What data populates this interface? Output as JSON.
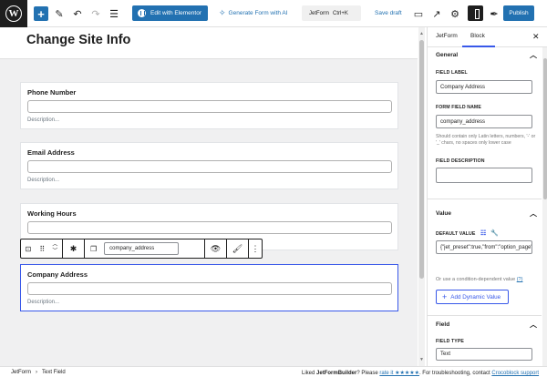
{
  "toolbar": {
    "logo": "W",
    "elementor_label": "Edit with Elementor",
    "generate_label": "Generate Form with AI",
    "command_label": "JetForm",
    "command_shortcut": "Ctrl+K",
    "save_draft_label": "Save draft",
    "publish_label": "Publish"
  },
  "editor": {
    "page_title": "Change Site Info",
    "fields": [
      {
        "label": "Phone Number",
        "description": "Description..."
      },
      {
        "label": "Email Address",
        "description": "Description..."
      },
      {
        "label": "Working Hours",
        "description": ""
      },
      {
        "label": "Company Address",
        "description": "Description..."
      }
    ],
    "block_toolbar": {
      "field_name_value": "company_address"
    }
  },
  "sidebar": {
    "tabs": [
      "JetForm",
      "Block"
    ],
    "active_tab": "Block",
    "general": {
      "title": "General",
      "field_label_label": "FIELD LABEL",
      "field_label_value": "Company Address",
      "form_field_name_label": "FORM FIELD NAME",
      "form_field_name_value": "company_address",
      "field_name_help": "Should contain only Latin letters, numbers, '-' or '_' chars, no spaces only lower case",
      "field_description_label": "FIELD DESCRIPTION",
      "field_description_value": ""
    },
    "value": {
      "title": "Value",
      "default_value_label": "DEFAULT VALUE",
      "default_value": "{\"jet_preset\":true,\"from\":\"option_page\"",
      "condition_text": "Or use a condition-dependent value",
      "condition_help": "(?)",
      "add_dynamic_label": "Add Dynamic Value"
    },
    "field": {
      "title": "Field",
      "field_type_label": "FIELD TYPE",
      "field_type_value": "Text"
    }
  },
  "footer": {
    "breadcrumb_root": "JetForm",
    "breadcrumb_current": "Text Field",
    "credit_prefix": "Liked ",
    "credit_brand": "JetFormBuilder",
    "credit_middle": "? Please ",
    "credit_rate": "rate it ★★★★★",
    "credit_suffix": ". For troubleshooting, contact ",
    "credit_support": "Crocoblock support"
  }
}
